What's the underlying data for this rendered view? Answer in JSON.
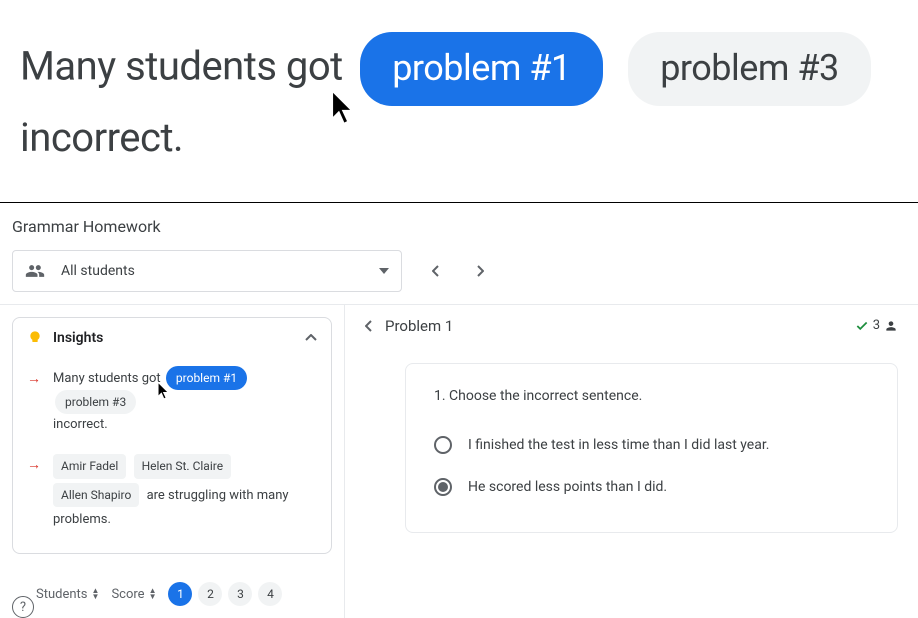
{
  "hero": {
    "prefix": "Many students got",
    "chip1": "problem #1",
    "chip2": "problem #3",
    "suffix": "incorrect."
  },
  "app": {
    "title": "Grammar Homework",
    "studentSelector": "All students"
  },
  "insights": {
    "title": "Insights",
    "item1": {
      "prefix": "Many students got",
      "chip1": "problem #1",
      "chip2": "problem #3",
      "suffix": "incorrect."
    },
    "item2": {
      "name1": "Amir Fadel",
      "name2": "Helen St. Claire",
      "name3": "Allen Shapiro",
      "suffix": "are struggling with many problems."
    }
  },
  "sort": {
    "students": "Students",
    "score": "Score",
    "pages": [
      "1",
      "2",
      "3",
      "4"
    ]
  },
  "problem": {
    "title": "Problem 1",
    "count": "3",
    "question": "1.  Choose the incorrect sentence.",
    "option1": "I finished the test in less time than I did last year.",
    "option2": "He scored less points than I did."
  }
}
